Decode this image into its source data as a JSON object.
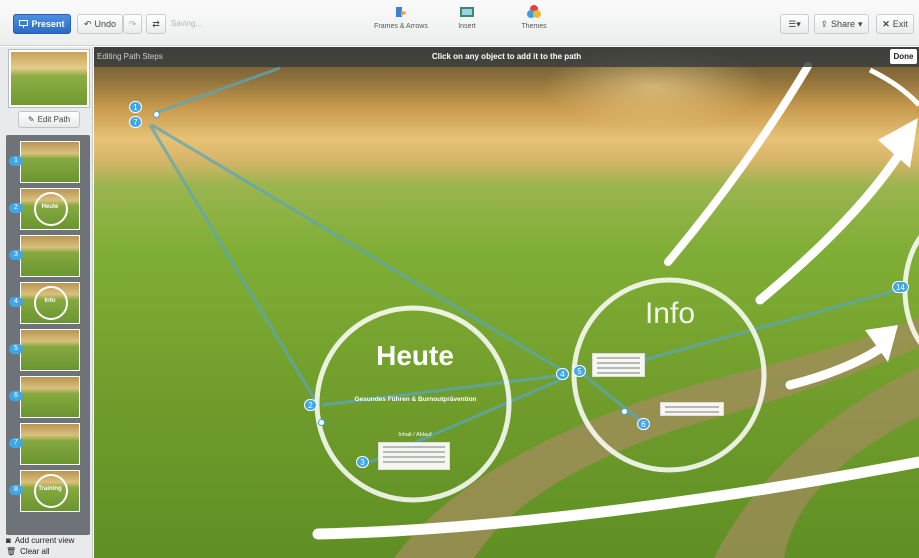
{
  "toolbar": {
    "present_label": "Present",
    "undo_label": "Undo",
    "saving_label": "Saving...",
    "frames_label": "Frames & Arrows",
    "insert_label": "Insert",
    "themes_label": "Themes",
    "share_label": "Share",
    "exit_label": "Exit"
  },
  "sidebar": {
    "edit_path_label": "Edit Path",
    "steps": [
      {
        "num": "1",
        "caption": ""
      },
      {
        "num": "2",
        "caption": "Heute"
      },
      {
        "num": "3",
        "caption": ""
      },
      {
        "num": "4",
        "caption": "Info"
      },
      {
        "num": "5",
        "caption": ""
      },
      {
        "num": "6",
        "caption": ""
      },
      {
        "num": "7",
        "caption": ""
      },
      {
        "num": "8",
        "caption": "Training"
      }
    ],
    "add_view_label": "Add current view",
    "clear_all_label": "Clear all"
  },
  "banner": {
    "mode_label": "Editing Path Steps",
    "instruction": "Click on any object to add it to the path",
    "done_label": "Done"
  },
  "canvas": {
    "heute_title": "Heute",
    "heute_subtitle": "Gesundes Führen & Burnoutprävention",
    "heute_small": "Inhalt / Ablauf",
    "info_title": "Info",
    "path_numbers": [
      "1",
      "7",
      "2",
      "3",
      "4",
      "5",
      "6",
      "14"
    ]
  },
  "colors": {
    "accent": "#3fa7e5",
    "present_button": "#2b6bc4",
    "banner": "#373c40"
  }
}
